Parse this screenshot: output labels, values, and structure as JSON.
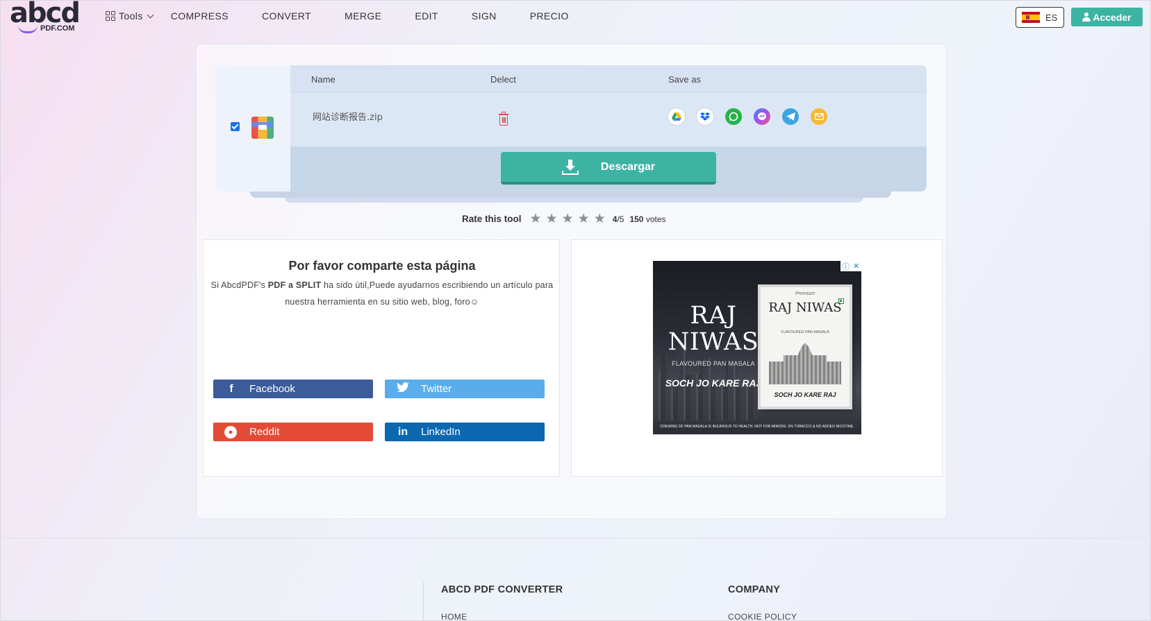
{
  "header": {
    "logo_main": "abcd",
    "logo_sub": "PDF.COM",
    "tools_label": "Tools",
    "nav": [
      "COMPRESS",
      "CONVERT",
      "MERGE",
      "EDIT",
      "SIGN",
      "PRECIO"
    ],
    "language": "ES",
    "login_label": "Acceder"
  },
  "file_table": {
    "columns": {
      "name": "Name",
      "delete": "Delect",
      "save_as": "Save as"
    },
    "file": {
      "name": "网站诊断报告.zip",
      "checked": true
    },
    "save_targets": [
      {
        "name": "google-drive-icon",
        "color": "#ffffff"
      },
      {
        "name": "dropbox-icon",
        "color": "#ffffff"
      },
      {
        "name": "whatsapp-icon",
        "color": "#25b34a"
      },
      {
        "name": "messenger-icon",
        "color": "#8a5cf0"
      },
      {
        "name": "telegram-icon",
        "color": "#3aa5e0"
      },
      {
        "name": "email-icon",
        "color": "#f4b83a"
      }
    ],
    "download_label": "Descargar"
  },
  "rating": {
    "label": "Rate this tool",
    "stars": 5,
    "score": "4",
    "out_of": "/5",
    "votes_count": "150",
    "votes_label": "votes"
  },
  "share": {
    "title": "Por favor comparte esta página",
    "text_prefix": "Si AbcdPDF's ",
    "tool_name": "PDF a SPLIT",
    "text_suffix": " ha sido útil,Puede ayudarnos escribiendo un artículo para nuestra herramienta en su sitio web, blog, foro☺",
    "buttons": {
      "facebook": "Facebook",
      "twitter": "Twitter",
      "reddit": "Reddit",
      "linkedin": "LinkedIn"
    }
  },
  "ad": {
    "brand": "RAJ NIWAS",
    "tagline": "FLAVOURED PAN MASALA",
    "slogan": "SOCH JO KARE RAJ",
    "pack_premium": "Premium",
    "pack_brand": "RAJ NIWAS",
    "pack_tagline": "FLAVOURED PAN MASALA",
    "pack_slogan": "SOCH JO KARE RAJ",
    "warning": "CHEWING OF PAN MASALA IS INJURIOUS TO HEALTH. NOT FOR MINORS. 0% TOBACCO & NO ADDED NICOTINE."
  },
  "footer": {
    "col1_title": "ABCD PDF CONVERTER",
    "col1_link": "HOME",
    "col2_title": "COMPANY",
    "col2_link": "COOKIE POLICY"
  }
}
